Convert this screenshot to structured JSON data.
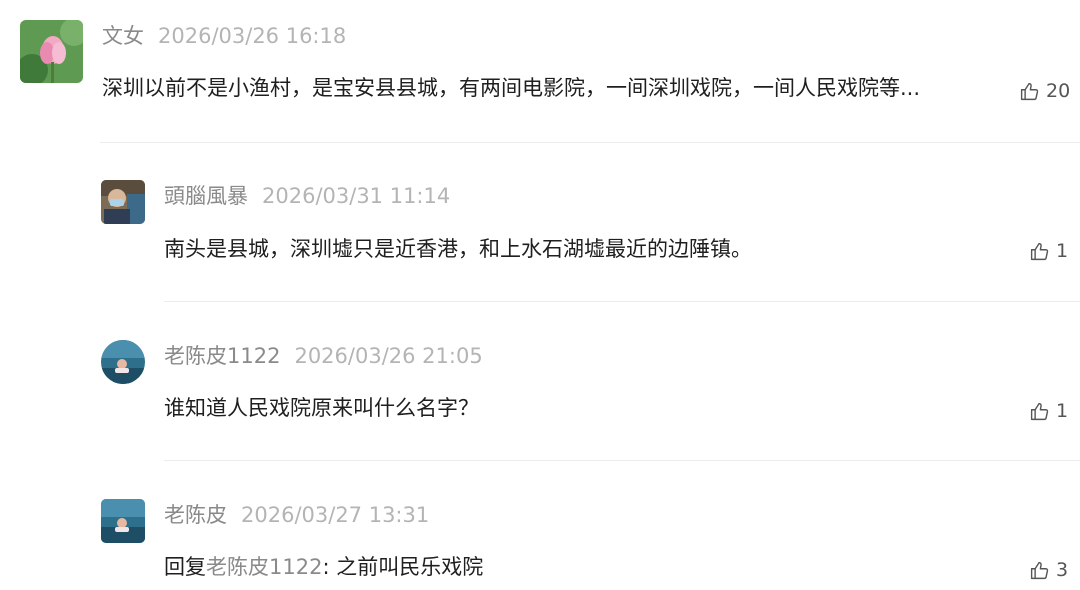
{
  "comments": [
    {
      "username": "文女",
      "time": "2026/03/26 16:18",
      "text": "深圳以前不是小渔村，是宝安县县城，有两间电影院，一间深圳戏院，一间人民戏院等...",
      "likes": "20",
      "avatar": "lotus-flower-photo"
    },
    {
      "username": "頭腦風暴",
      "time": "2026/03/31 11:14",
      "text": "南头是县城，深圳墟只是近香港，和上水石湖墟最近的边陲镇。",
      "likes": "1",
      "avatar": "person-with-mask-photo"
    },
    {
      "username": "老陈皮1122",
      "time": "2026/03/26 21:05",
      "text": "谁知道人民戏院原来叫什么名字？",
      "likes": "1",
      "avatar": "person-in-water-photo"
    },
    {
      "username": "老陈皮",
      "time": "2026/03/27 13:31",
      "reply_prefix": "回复",
      "reply_target": "老陈皮1122",
      "reply_text": ": 之前叫民乐戏院",
      "likes": "3",
      "avatar": "person-in-water-photo"
    }
  ],
  "like_icon": "thumbs-up-icon"
}
